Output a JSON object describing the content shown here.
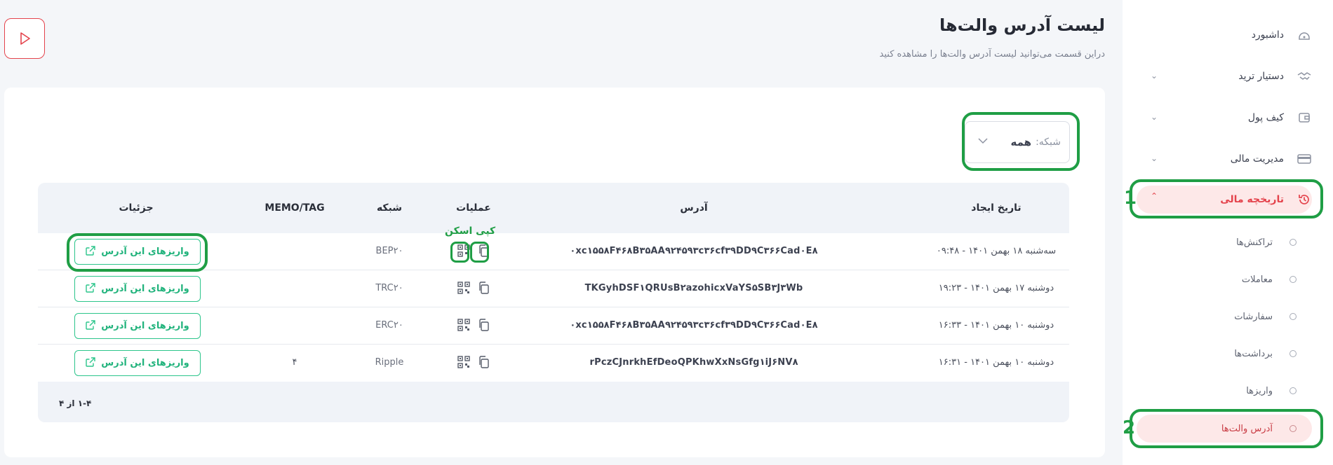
{
  "header": {
    "title": "لیست آدرس والت‌ها",
    "subtitle": "دراین قسمت می‌توانید لیست آدرس والت‌ها را مشاهده کنید"
  },
  "sidebar": {
    "items": [
      {
        "label": "داشبورد",
        "icon": "dashboard-icon"
      },
      {
        "label": "دستیار ترید",
        "icon": "handshake-icon"
      },
      {
        "label": "کیف پول",
        "icon": "wallet-icon"
      },
      {
        "label": "مدیریت مالی",
        "icon": "card-icon"
      },
      {
        "label": "تاریخچه مالی",
        "icon": "history-icon"
      }
    ],
    "subitems": [
      {
        "label": "تراکنش‌ها"
      },
      {
        "label": "معاملات"
      },
      {
        "label": "سفارشات"
      },
      {
        "label": "برداشت‌ها"
      },
      {
        "label": "واریزها"
      },
      {
        "label": "آدرس والت‌ها"
      }
    ]
  },
  "filter": {
    "label": "شبکه:",
    "value": "همه"
  },
  "table": {
    "columns": {
      "created": "تاریخ ایجاد",
      "address": "آدرس",
      "operations": "عملیات",
      "network": "شبکه",
      "memo": "MEMO/TAG",
      "details": "جزئیات"
    },
    "rows": [
      {
        "date": "سه‌شنبه ۱۸ بهمن ۱۴۰۱ - ۰۹:۴۸",
        "address": "۰xc۱۵۵۸F۴۶۸B۳۵AA۹۲۴۵۹۳c۳۶cf۳۹DD۹C۳۶۶Cad۰E۸",
        "network": "BEP۲۰",
        "memo": "",
        "action": "واریزهای این آدرس"
      },
      {
        "date": "دوشنبه ۱۷ بهمن ۱۴۰۱ - ۱۹:۲۳",
        "address": "TKGyhDSF۱QRUsB۲azohicxVaYS۵SB۳J۳Wb",
        "network": "TRC۲۰",
        "memo": "",
        "action": "واریزهای این آدرس"
      },
      {
        "date": "دوشنبه ۱۰ بهمن ۱۴۰۱ - ۱۶:۳۳",
        "address": "۰xc۱۵۵۸F۴۶۸B۳۵AA۹۲۴۵۹۳c۳۶cf۳۹DD۹C۳۶۶Cad۰E۸",
        "network": "ERC۲۰",
        "memo": "",
        "action": "واریزهای این آدرس"
      },
      {
        "date": "دوشنبه ۱۰ بهمن ۱۴۰۱ - ۱۶:۳۱",
        "address": "rPczCJnrkhEfDeoQPKhwXxNsGfg۱iJ۶NV۸",
        "network": "Ripple",
        "memo": "۴",
        "action": "واریزهای این آدرس"
      }
    ],
    "pagination": "۱-۴ از ۴"
  },
  "annotations": {
    "step1": "1",
    "step2": "2",
    "ops_hint": "کپی اسکن"
  },
  "colors": {
    "accent": "#e4434c",
    "success": "#21b37c",
    "highlight": "#1f9e45"
  }
}
